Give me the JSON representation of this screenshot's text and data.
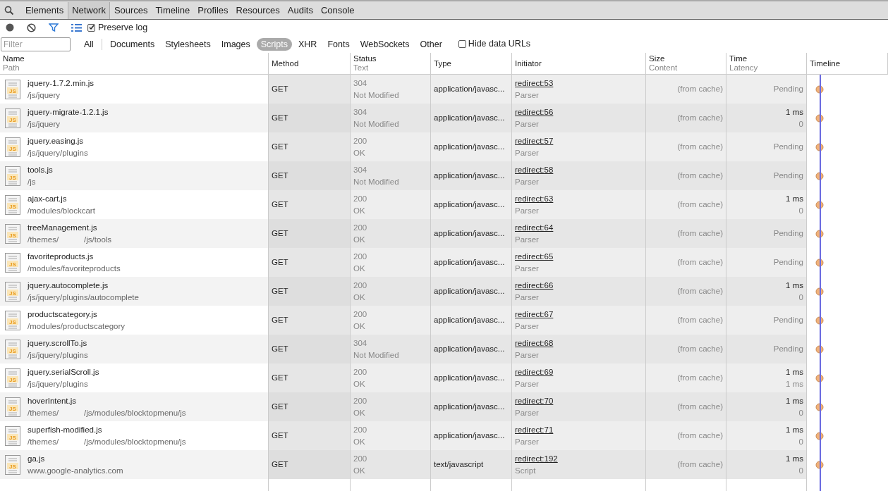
{
  "panel_tabs": [
    {
      "label": "Elements",
      "selected": false
    },
    {
      "label": "Network",
      "selected": true
    },
    {
      "label": "Sources",
      "selected": false
    },
    {
      "label": "Timeline",
      "selected": false
    },
    {
      "label": "Profiles",
      "selected": false
    },
    {
      "label": "Resources",
      "selected": false
    },
    {
      "label": "Audits",
      "selected": false
    },
    {
      "label": "Console",
      "selected": false
    }
  ],
  "toolbar": {
    "preserve_log": {
      "label": "Preserve log",
      "checked": true
    }
  },
  "filter_bar": {
    "placeholder": "Filter",
    "types": [
      {
        "label": "All",
        "selected": false
      },
      {
        "label": "Documents",
        "selected": false
      },
      {
        "label": "Stylesheets",
        "selected": false
      },
      {
        "label": "Images",
        "selected": false
      },
      {
        "label": "Scripts",
        "selected": true
      },
      {
        "label": "XHR",
        "selected": false
      },
      {
        "label": "Fonts",
        "selected": false
      },
      {
        "label": "WebSockets",
        "selected": false
      },
      {
        "label": "Other",
        "selected": false
      }
    ],
    "hide_data_urls": {
      "label": "Hide data URLs",
      "checked": false
    }
  },
  "table": {
    "columns": [
      {
        "title": "Name",
        "subtitle": "Path"
      },
      {
        "title": "Method"
      },
      {
        "title": "Status",
        "subtitle": "Text"
      },
      {
        "title": "Type"
      },
      {
        "title": "Initiator"
      },
      {
        "title": "Size",
        "subtitle": "Content"
      },
      {
        "title": "Time",
        "subtitle": "Latency"
      },
      {
        "title": "Timeline"
      }
    ],
    "rows": [
      {
        "icon_label": "JS",
        "name": "jquery-1.7.2.min.js",
        "path": [
          "/js/jquery"
        ],
        "method": "GET",
        "status": "304",
        "status_text": "Not Modified",
        "type": "application/javasc...",
        "initiator": "redirect:53",
        "initiator_type": "Parser",
        "size": "(from cache)",
        "time": "Pending"
      },
      {
        "icon_label": "JS",
        "name": "jquery-migrate-1.2.1.js",
        "path": [
          "/js/jquery"
        ],
        "method": "GET",
        "status": "304",
        "status_text": "Not Modified",
        "type": "application/javasc...",
        "initiator": "redirect:56",
        "initiator_type": "Parser",
        "size": "(from cache)",
        "time": "1 ms",
        "latency": "0"
      },
      {
        "icon_label": "JS",
        "name": "jquery.easing.js",
        "path": [
          "/js/jquery/plugins"
        ],
        "method": "GET",
        "status": "200",
        "status_text": "OK",
        "type": "application/javasc...",
        "initiator": "redirect:57",
        "initiator_type": "Parser",
        "size": "(from cache)",
        "time": "Pending"
      },
      {
        "icon_label": "JS",
        "name": "tools.js",
        "path": [
          "/js"
        ],
        "method": "GET",
        "status": "304",
        "status_text": "Not Modified",
        "type": "application/javasc...",
        "initiator": "redirect:58",
        "initiator_type": "Parser",
        "size": "(from cache)",
        "time": "Pending"
      },
      {
        "icon_label": "JS",
        "name": "ajax-cart.js",
        "path": [
          "/modules/blockcart"
        ],
        "method": "GET",
        "status": "200",
        "status_text": "OK",
        "type": "application/javasc...",
        "initiator": "redirect:63",
        "initiator_type": "Parser",
        "size": "(from cache)",
        "time": "1 ms",
        "latency": "0"
      },
      {
        "icon_label": "JS",
        "name": "treeManagement.js",
        "path": [
          "/themes/",
          "/js/tools"
        ],
        "method": "GET",
        "status": "200",
        "status_text": "OK",
        "type": "application/javasc...",
        "initiator": "redirect:64",
        "initiator_type": "Parser",
        "size": "(from cache)",
        "time": "Pending"
      },
      {
        "icon_label": "JS",
        "name": "favoriteproducts.js",
        "path": [
          "/modules/favoriteproducts"
        ],
        "method": "GET",
        "status": "200",
        "status_text": "OK",
        "type": "application/javasc...",
        "initiator": "redirect:65",
        "initiator_type": "Parser",
        "size": "(from cache)",
        "time": "Pending"
      },
      {
        "icon_label": "JS",
        "name": "jquery.autocomplete.js",
        "path": [
          "/js/jquery/plugins/autocomplete"
        ],
        "method": "GET",
        "status": "200",
        "status_text": "OK",
        "type": "application/javasc...",
        "initiator": "redirect:66",
        "initiator_type": "Parser",
        "size": "(from cache)",
        "time": "1 ms",
        "latency": "0"
      },
      {
        "icon_label": "JS",
        "name": "productscategory.js",
        "path": [
          "/modules/productscategory"
        ],
        "method": "GET",
        "status": "200",
        "status_text": "OK",
        "type": "application/javasc...",
        "initiator": "redirect:67",
        "initiator_type": "Parser",
        "size": "(from cache)",
        "time": "Pending"
      },
      {
        "icon_label": "JS",
        "name": "jquery.scrollTo.js",
        "path": [
          "/js/jquery/plugins"
        ],
        "method": "GET",
        "status": "304",
        "status_text": "Not Modified",
        "type": "application/javasc...",
        "initiator": "redirect:68",
        "initiator_type": "Parser",
        "size": "(from cache)",
        "time": "Pending"
      },
      {
        "icon_label": "JS",
        "name": "jquery.serialScroll.js",
        "path": [
          "/js/jquery/plugins"
        ],
        "method": "GET",
        "status": "200",
        "status_text": "OK",
        "type": "application/javasc...",
        "initiator": "redirect:69",
        "initiator_type": "Parser",
        "size": "(from cache)",
        "time": "1 ms",
        "latency": "1 ms"
      },
      {
        "icon_label": "JS",
        "name": "hoverIntent.js",
        "path": [
          "/themes/",
          "/js/modules/blocktopmenu/js"
        ],
        "method": "GET",
        "status": "200",
        "status_text": "OK",
        "type": "application/javasc...",
        "initiator": "redirect:70",
        "initiator_type": "Parser",
        "size": "(from cache)",
        "time": "1 ms",
        "latency": "0"
      },
      {
        "icon_label": "JS",
        "name": "superfish-modified.js",
        "path": [
          "/themes/",
          "/js/modules/blocktopmenu/js"
        ],
        "method": "GET",
        "status": "200",
        "status_text": "OK",
        "type": "application/javasc...",
        "initiator": "redirect:71",
        "initiator_type": "Parser",
        "size": "(from cache)",
        "time": "1 ms",
        "latency": "0"
      },
      {
        "icon_label": "JS",
        "name": "ga.js",
        "path": [
          "www.google-analytics.com"
        ],
        "method": "GET",
        "status": "200",
        "status_text": "OK",
        "type": "text/javascript",
        "initiator": "redirect:192",
        "initiator_type": "Script",
        "size": "(from cache)",
        "time": "1 ms",
        "latency": "0"
      }
    ]
  }
}
